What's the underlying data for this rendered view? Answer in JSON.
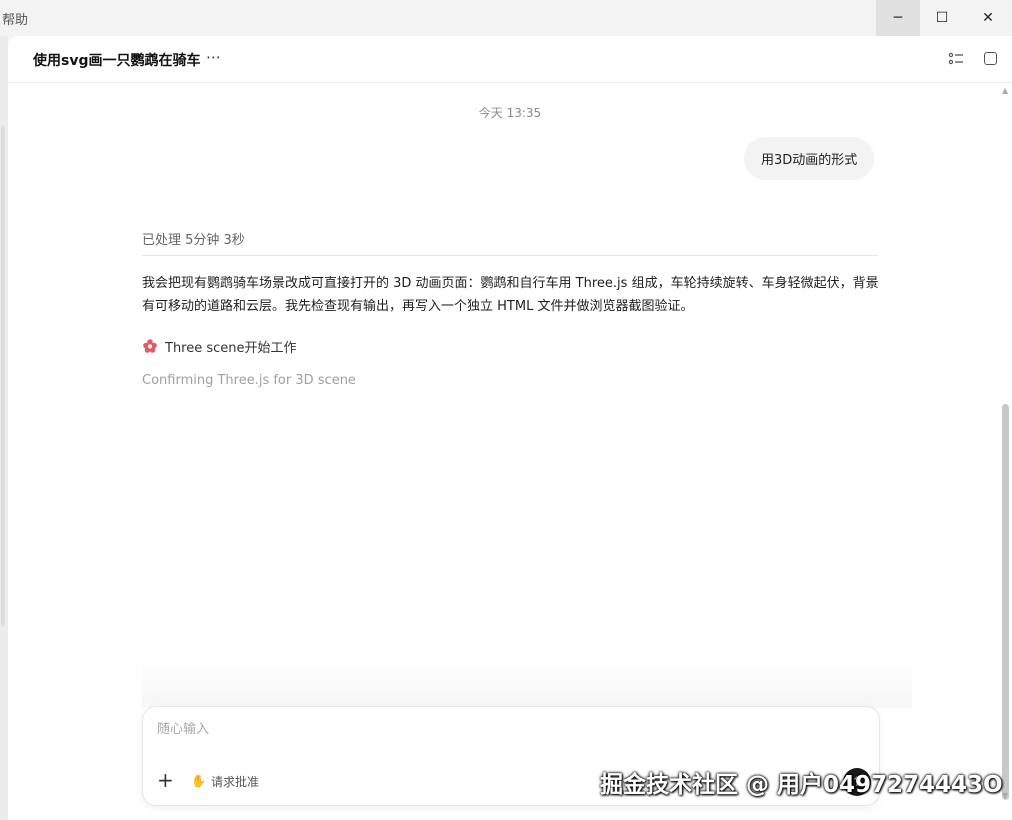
{
  "window": {
    "menu_help": "帮助",
    "minimize_icon": "─",
    "maximize_icon": "☐",
    "close_icon": "✕"
  },
  "header": {
    "title": "使用svg画一只鹦鹉在骑车",
    "more_icon": "⋯"
  },
  "chat": {
    "timestamp": "今天 13:35",
    "user_message": "用3D动画的形式",
    "processed_label": "已处理 5分钟 3秒",
    "assistant_text": "我会把现有鹦鹉骑车场景改成可直接打开的 3D 动画页面：鹦鹉和自行车用 Three.js 组成，车轮持续旋转、车身轻微起伏，背景有可移动的道路和云层。我先检查现有输出，再写入一个独立 HTML 文件并做浏览器截图验证。",
    "task_label": "Three scene开始工作",
    "status_text": "Confirming Three.js for 3D scene"
  },
  "composer": {
    "placeholder": "随心输入",
    "plus_icon": "+",
    "approval_icon": "✋",
    "approval_label": "请求批准",
    "send_icon": "↑"
  },
  "watermark": "掘金技术社区 @ 用户0497274443O",
  "colors": {
    "accent_flower": "#e05a68",
    "send_button": "#1a1a1a"
  }
}
